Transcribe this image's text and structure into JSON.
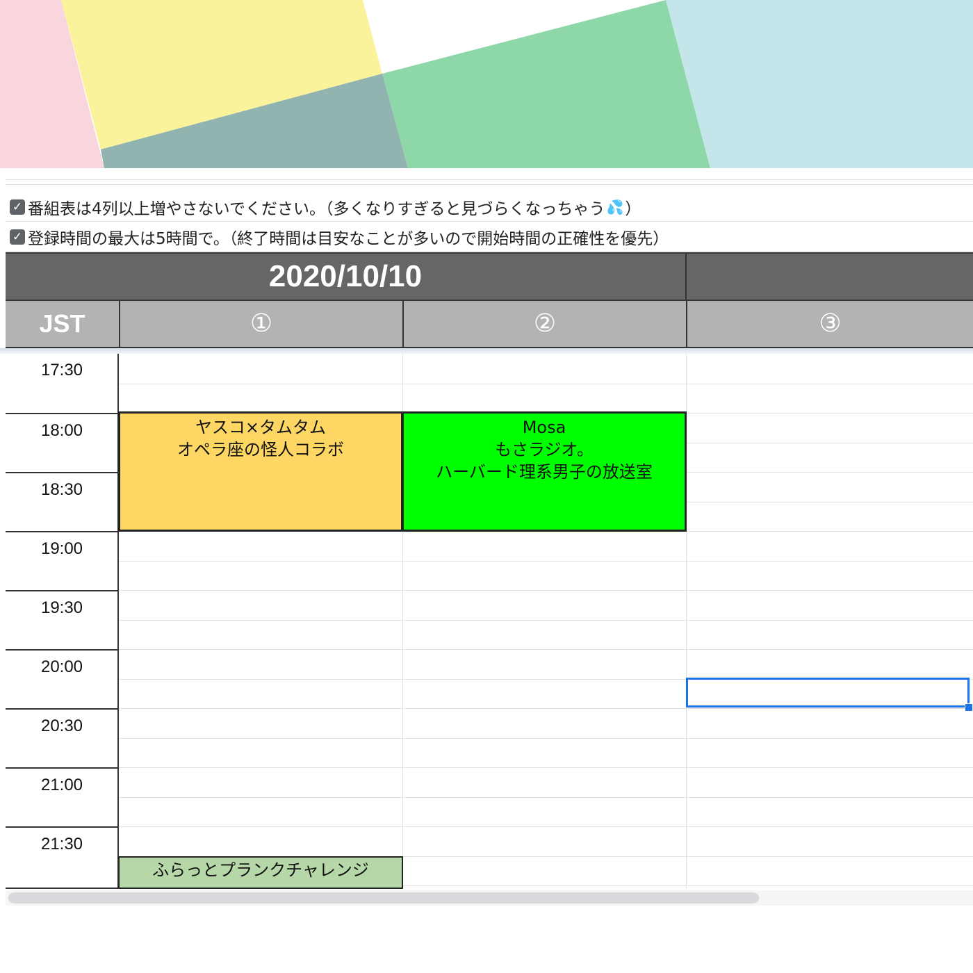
{
  "banner": {
    "colors": [
      "#f9d5dd",
      "#fbf29c",
      "#ffffff",
      "#8ed7a9",
      "#c4e5ea",
      "#92b4b0"
    ]
  },
  "notes": [
    {
      "icon": "checkbox-checked-icon",
      "text": "番組表は4列以上増やさないでください。（多くなりすぎると見づらくなっちゃう",
      "suffix": "）",
      "emoji_icon": "sweat-droplets-icon"
    },
    {
      "icon": "checkbox-checked-icon",
      "text": "登録時間の最大は5時間で。（終了時間は目安なことが多いので開始時間の正確性を優先）"
    }
  ],
  "schedule": {
    "date": "2020/10/10",
    "columns": [
      "JST",
      "①",
      "②",
      "③"
    ],
    "times": [
      "17:30",
      "18:00",
      "18:30",
      "19:00",
      "19:30",
      "20:00",
      "20:30",
      "21:00",
      "21:30"
    ],
    "events": [
      {
        "column": "①",
        "start": "18:00",
        "end": "19:00",
        "lines": [
          "ヤスコ×タムタム",
          "オペラ座の怪人コラボ"
        ],
        "color": "#fdd663"
      },
      {
        "column": "②",
        "start": "18:00",
        "end": "19:00",
        "lines": [
          "Mosa",
          "もさラジオ。",
          "ハーバード理系男子の放送室"
        ],
        "color": "#00ff00"
      },
      {
        "column": "①",
        "start": "21:45",
        "end": "22:00",
        "lines": [
          "ふらっとプランクチャレンジ"
        ],
        "color": "#b6d7a8"
      }
    ],
    "selected_cell": {
      "column": "③",
      "time": "20:15"
    }
  },
  "colors": {
    "date_header_bg": "#666666",
    "column_header_bg": "#b3b3b3",
    "selection": "#1a73e8"
  }
}
